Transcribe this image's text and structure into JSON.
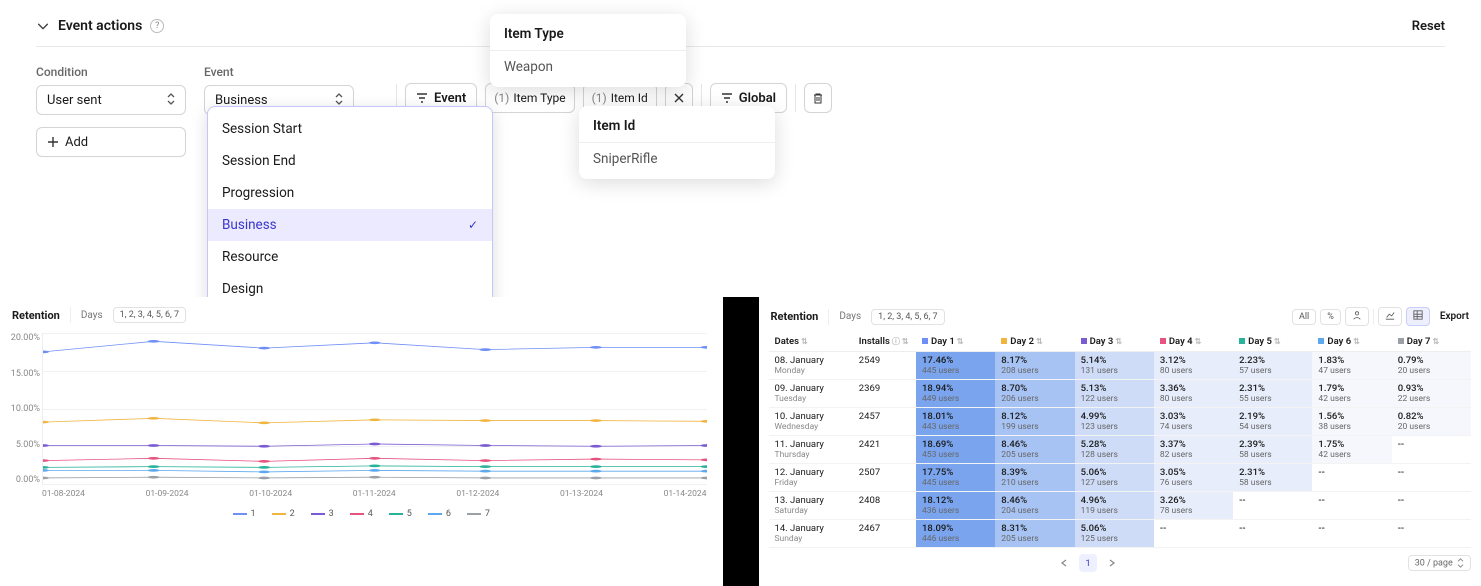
{
  "header": {
    "title": "Event actions",
    "reset": "Reset"
  },
  "condition": {
    "label": "Condition",
    "value": "User sent"
  },
  "event": {
    "label": "Event",
    "value": "Business",
    "options": [
      "Session Start",
      "Session End",
      "Progression",
      "Business",
      "Resource",
      "Design"
    ],
    "selected": "Business"
  },
  "filters": {
    "event_button": "Event",
    "chips": [
      {
        "count": "(1)",
        "label": "Item Type"
      },
      {
        "count": "(1)",
        "label": "Item Id"
      }
    ],
    "global_button": "Global"
  },
  "add": "Add",
  "popover_itemtype": {
    "title": "Item Type",
    "value": "Weapon"
  },
  "popover_itemid": {
    "title": "Item Id",
    "value": "SniperRifle"
  },
  "retention": {
    "title": "Retention",
    "days_label": "Days",
    "days_value": "1, 2, 3, 4, 5, 6, 7",
    "controls": {
      "all": "All",
      "pct": "%",
      "users_icon": "users",
      "export": "Export"
    },
    "pager": {
      "page": "1",
      "perpage": "30 / page"
    }
  },
  "chart_data": {
    "type": "line",
    "xlabel": "",
    "ylabel": "",
    "ylim": [
      0,
      20
    ],
    "y_ticks": [
      "20.00%",
      "15.00%",
      "10.00%",
      "5.00%",
      "0.00%"
    ],
    "categories": [
      "01-08-2024",
      "01-09-2024",
      "01-10-2024",
      "01-11-2024",
      "01-12-2024",
      "01-13-2024",
      "01-14-2024"
    ],
    "series": [
      {
        "name": "1",
        "color": "#6f8ef7",
        "values": [
          17.5,
          18.9,
          18.0,
          18.7,
          17.8,
          18.1,
          18.1
        ]
      },
      {
        "name": "2",
        "color": "#f1b43f",
        "values": [
          8.2,
          8.7,
          8.1,
          8.5,
          8.4,
          8.4,
          8.3
        ]
      },
      {
        "name": "3",
        "color": "#7a5bd1",
        "values": [
          5.1,
          5.1,
          5.0,
          5.3,
          5.1,
          5.0,
          5.1
        ]
      },
      {
        "name": "4",
        "color": "#e6537e",
        "values": [
          3.1,
          3.4,
          3.0,
          3.4,
          3.1,
          3.3,
          3.2
        ]
      },
      {
        "name": "5",
        "color": "#29b39a",
        "values": [
          2.2,
          2.3,
          2.2,
          2.4,
          2.3,
          2.3,
          2.3
        ]
      },
      {
        "name": "6",
        "color": "#5da8ef",
        "values": [
          1.8,
          1.8,
          1.6,
          1.8,
          1.7,
          1.7,
          1.7
        ]
      },
      {
        "name": "7",
        "color": "#9aa0a6",
        "values": [
          0.8,
          0.9,
          0.8,
          0.9,
          0.8,
          0.8,
          0.8
        ]
      }
    ]
  },
  "retention_table": {
    "columns": [
      "Dates",
      "Installs",
      "Day 1",
      "Day 2",
      "Day 3",
      "Day 4",
      "Day 5",
      "Day 6",
      "Day 7"
    ],
    "day_colors": [
      "#6f8ef7",
      "#f1b43f",
      "#7a5bd1",
      "#e6537e",
      "#29b39a",
      "#5da8ef",
      "#9aa0a6"
    ],
    "rows": [
      {
        "date": "08. January",
        "dow": "Monday",
        "installs": "2549",
        "cells": [
          {
            "p": "17.46%",
            "u": "445 users"
          },
          {
            "p": "8.17%",
            "u": "208 users"
          },
          {
            "p": "5.14%",
            "u": "131 users"
          },
          {
            "p": "3.12%",
            "u": "80 users"
          },
          {
            "p": "2.23%",
            "u": "57 users"
          },
          {
            "p": "1.83%",
            "u": "47 users"
          },
          {
            "p": "0.79%",
            "u": "20 users"
          }
        ]
      },
      {
        "date": "09. January",
        "dow": "Tuesday",
        "installs": "2369",
        "cells": [
          {
            "p": "18.94%",
            "u": "449 users"
          },
          {
            "p": "8.70%",
            "u": "206 users"
          },
          {
            "p": "5.13%",
            "u": "122 users"
          },
          {
            "p": "3.36%",
            "u": "80 users"
          },
          {
            "p": "2.31%",
            "u": "55 users"
          },
          {
            "p": "1.79%",
            "u": "42 users"
          },
          {
            "p": "0.93%",
            "u": "22 users"
          }
        ]
      },
      {
        "date": "10. January",
        "dow": "Wednesday",
        "installs": "2457",
        "cells": [
          {
            "p": "18.01%",
            "u": "443 users"
          },
          {
            "p": "8.12%",
            "u": "199 users"
          },
          {
            "p": "4.99%",
            "u": "123 users"
          },
          {
            "p": "3.03%",
            "u": "74 users"
          },
          {
            "p": "2.19%",
            "u": "54 users"
          },
          {
            "p": "1.56%",
            "u": "38 users"
          },
          {
            "p": "0.82%",
            "u": "20 users"
          }
        ]
      },
      {
        "date": "11. January",
        "dow": "Thursday",
        "installs": "2421",
        "cells": [
          {
            "p": "18.69%",
            "u": "453 users"
          },
          {
            "p": "8.46%",
            "u": "205 users"
          },
          {
            "p": "5.28%",
            "u": "128 users"
          },
          {
            "p": "3.37%",
            "u": "82 users"
          },
          {
            "p": "2.39%",
            "u": "58 users"
          },
          {
            "p": "1.75%",
            "u": "42 users"
          },
          {
            "p": "--",
            "u": ""
          }
        ]
      },
      {
        "date": "12. January",
        "dow": "Friday",
        "installs": "2507",
        "cells": [
          {
            "p": "17.75%",
            "u": "445 users"
          },
          {
            "p": "8.39%",
            "u": "210 users"
          },
          {
            "p": "5.06%",
            "u": "127 users"
          },
          {
            "p": "3.05%",
            "u": "76 users"
          },
          {
            "p": "2.31%",
            "u": "58 users"
          },
          {
            "p": "--",
            "u": ""
          },
          {
            "p": "--",
            "u": ""
          }
        ]
      },
      {
        "date": "13. January",
        "dow": "Saturday",
        "installs": "2408",
        "cells": [
          {
            "p": "18.12%",
            "u": "436 users"
          },
          {
            "p": "8.46%",
            "u": "204 users"
          },
          {
            "p": "4.96%",
            "u": "119 users"
          },
          {
            "p": "3.26%",
            "u": "78 users"
          },
          {
            "p": "--",
            "u": ""
          },
          {
            "p": "--",
            "u": ""
          },
          {
            "p": "--",
            "u": ""
          }
        ]
      },
      {
        "date": "14. January",
        "dow": "Sunday",
        "installs": "2467",
        "cells": [
          {
            "p": "18.09%",
            "u": "446 users"
          },
          {
            "p": "8.31%",
            "u": "205 users"
          },
          {
            "p": "5.06%",
            "u": "125 users"
          },
          {
            "p": "--",
            "u": ""
          },
          {
            "p": "--",
            "u": ""
          },
          {
            "p": "--",
            "u": ""
          },
          {
            "p": "--",
            "u": ""
          }
        ]
      }
    ]
  }
}
